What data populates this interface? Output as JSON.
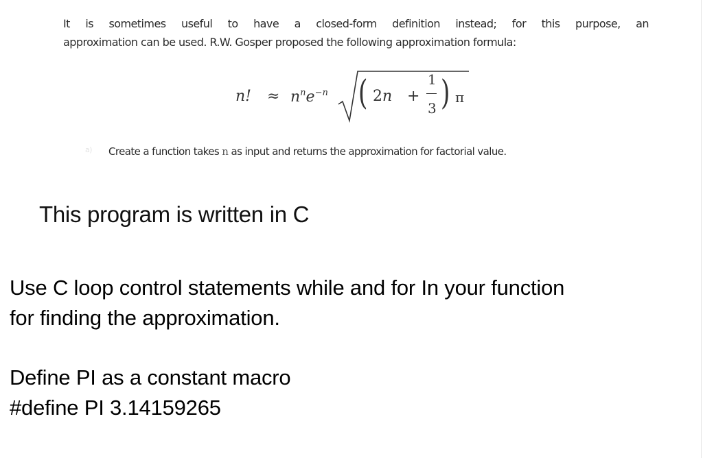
{
  "problem_image": {
    "intro_line1": "It is sometimes useful to have a closed-form definition instead; for this purpose, an",
    "intro_line2": "approximation can be used. R.W. Gosper proposed the following approximation formula:",
    "formula": {
      "lhs": "n!",
      "approx_symbol": "≈",
      "base": "n",
      "base_exponent": "n",
      "e_term": "e",
      "e_exponent": "−n",
      "inner_term_coef": "2",
      "inner_term_var": "n",
      "plus": "+",
      "fraction_numerator": "1",
      "fraction_denominator": "3",
      "pi": "π",
      "left_paren": "(",
      "right_paren": ")"
    },
    "task_bullet": "a)",
    "task_before": "Create a function takes ",
    "task_var": "n",
    "task_after": " as input and returns the approximation for factorial value."
  },
  "heading": "This program is written in C",
  "paragraph1_line1": "Use C loop control statements while and for In your function",
  "paragraph1_line2": "for finding the approximation.",
  "paragraph2_line1": "Define PI as a constant macro",
  "paragraph2_line2": "#define PI 3.14159265"
}
